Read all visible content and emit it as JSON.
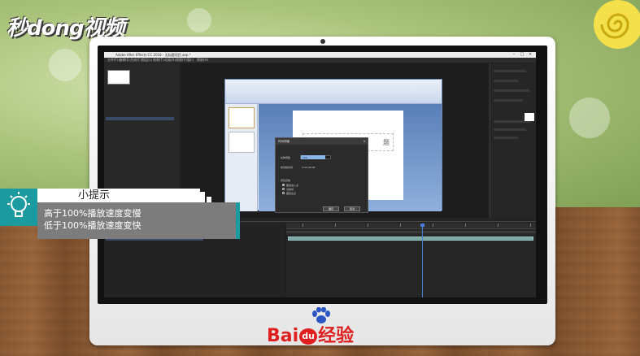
{
  "watermark": {
    "text": "秒dong视频"
  },
  "app": {
    "title": "Adobe After Effects CC 2018 - 无标题项目.aep *",
    "menu": [
      "文件(F)",
      "编辑(E)",
      "合成(C)",
      "图层(L)",
      "效果(T)",
      "动画(A)",
      "视图(V)",
      "窗口",
      "帮助(H)"
    ]
  },
  "ppt": {
    "slide_title": "题"
  },
  "dialog": {
    "title": "时间伸缩",
    "field_stretch": "拉伸因数",
    "field_duration": "新持续时间",
    "value_percent": "100",
    "value_duration": "0:00:48:08",
    "group_label": "原位定格",
    "options": [
      "图层进入点",
      "当前帧",
      "图层出点"
    ],
    "ok_label": "确定",
    "cancel_label": "取消"
  },
  "tip": {
    "header": "小提示",
    "lines": [
      "高于100%播放速度变慢",
      "低于100%播放速度变快"
    ]
  },
  "brand": {
    "text_left": "Bai",
    "text_du": "du",
    "text_right": "经验"
  },
  "colors": {
    "accent": "#1b9aa0",
    "brand_red": "#e02020"
  }
}
